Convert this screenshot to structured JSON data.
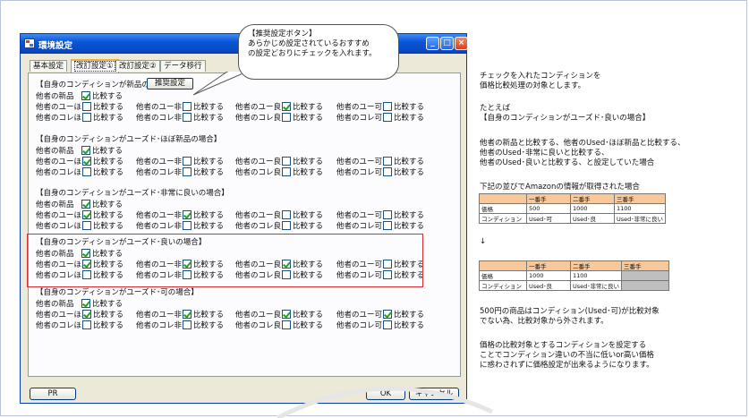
{
  "window": {
    "title": "環境設定"
  },
  "tabs": [
    "基本設定",
    "改訂設定①",
    "改訂設定②",
    "データ移行"
  ],
  "common": {
    "compare": "比較する"
  },
  "labels": {
    "new": "他者の新品",
    "ug": "他者のユーほ",
    "un": "他者のユー非",
    "ur": "他者のユー良",
    "uk": "他者のユー可",
    "cg": "他者のコレほ",
    "cn": "他者のコレ非",
    "cr": "他者のコレ良",
    "ck": "他者のコレ可"
  },
  "sections": [
    {
      "header": "【自身のコンディションが新品の場合】",
      "checks": [
        true,
        false,
        false,
        true,
        false,
        false,
        false,
        false,
        false
      ]
    },
    {
      "header": "【自身のコンディションがユーズド･ほぼ新品の場合】",
      "checks": [
        true,
        true,
        false,
        false,
        false,
        false,
        false,
        false,
        false
      ]
    },
    {
      "header": "【自身のコンディションがユーズド･非常に良いの場合】",
      "checks": [
        true,
        true,
        true,
        false,
        false,
        false,
        false,
        false,
        false
      ]
    },
    {
      "header": "【自身のコンディションがユーズド･良いの場合】",
      "checks": [
        true,
        true,
        true,
        true,
        false,
        false,
        false,
        false,
        false
      ]
    },
    {
      "header": "【自身のコンディションがユーズド･可の場合】",
      "checks": [
        true,
        true,
        true,
        true,
        true,
        false,
        false,
        false,
        false
      ]
    }
  ],
  "buttons": {
    "recommended": "推奨設定",
    "pr": "PR",
    "ok": "OK",
    "cancel": "キャンセル"
  },
  "callout": {
    "line1": "【推奨設定ボタン】",
    "line2": "あらかじめ設定されているおすすめ",
    "line3": "の設定どおりにチェックを入れます。"
  },
  "explanation": {
    "p1a": "チェックを入れたコンディションを",
    "p1b": "価格比較処理の対象とします。",
    "p2a": "たとえば",
    "p2b": "【自身のコンディションがユーズド･良いの場合】",
    "p3a": "他者の新品と比較する、他者のUsed･ほぼ新品と比較する、",
    "p3b": "他者のUsed･非常に良いと比較する、",
    "p3c": "他者のUsed･良いと比較する、と設定していた場合",
    "p4": "下記の並びでAmazonの情報が取得された場合",
    "arrow": "↓",
    "p5a": "500円の商品はコンディション(Used･可)が比較対象",
    "p5b": "でない為、比較対象から外されます。",
    "p6a": "価格の比較対象とするコンディションを設定する",
    "p6b": "ことでコンディション違いの不当に低いor高い価格",
    "p6c": "に惑わされずに価格設定が出来るようになります。"
  },
  "table1": {
    "headers": [
      "",
      "一番手",
      "二番手",
      "三番手"
    ],
    "rows": [
      [
        "価格",
        "500",
        "1000",
        "1100"
      ],
      [
        "コンディション",
        "Used･可",
        "Used･良",
        "Used･非常に良い"
      ]
    ]
  },
  "table2": {
    "headers": [
      "",
      "一番手",
      "二番手",
      "三番手"
    ],
    "rows": [
      [
        "価格",
        "1000",
        "1100",
        ""
      ],
      [
        "コンディション",
        "Used･良",
        "Used･非常に良い",
        ""
      ]
    ]
  }
}
